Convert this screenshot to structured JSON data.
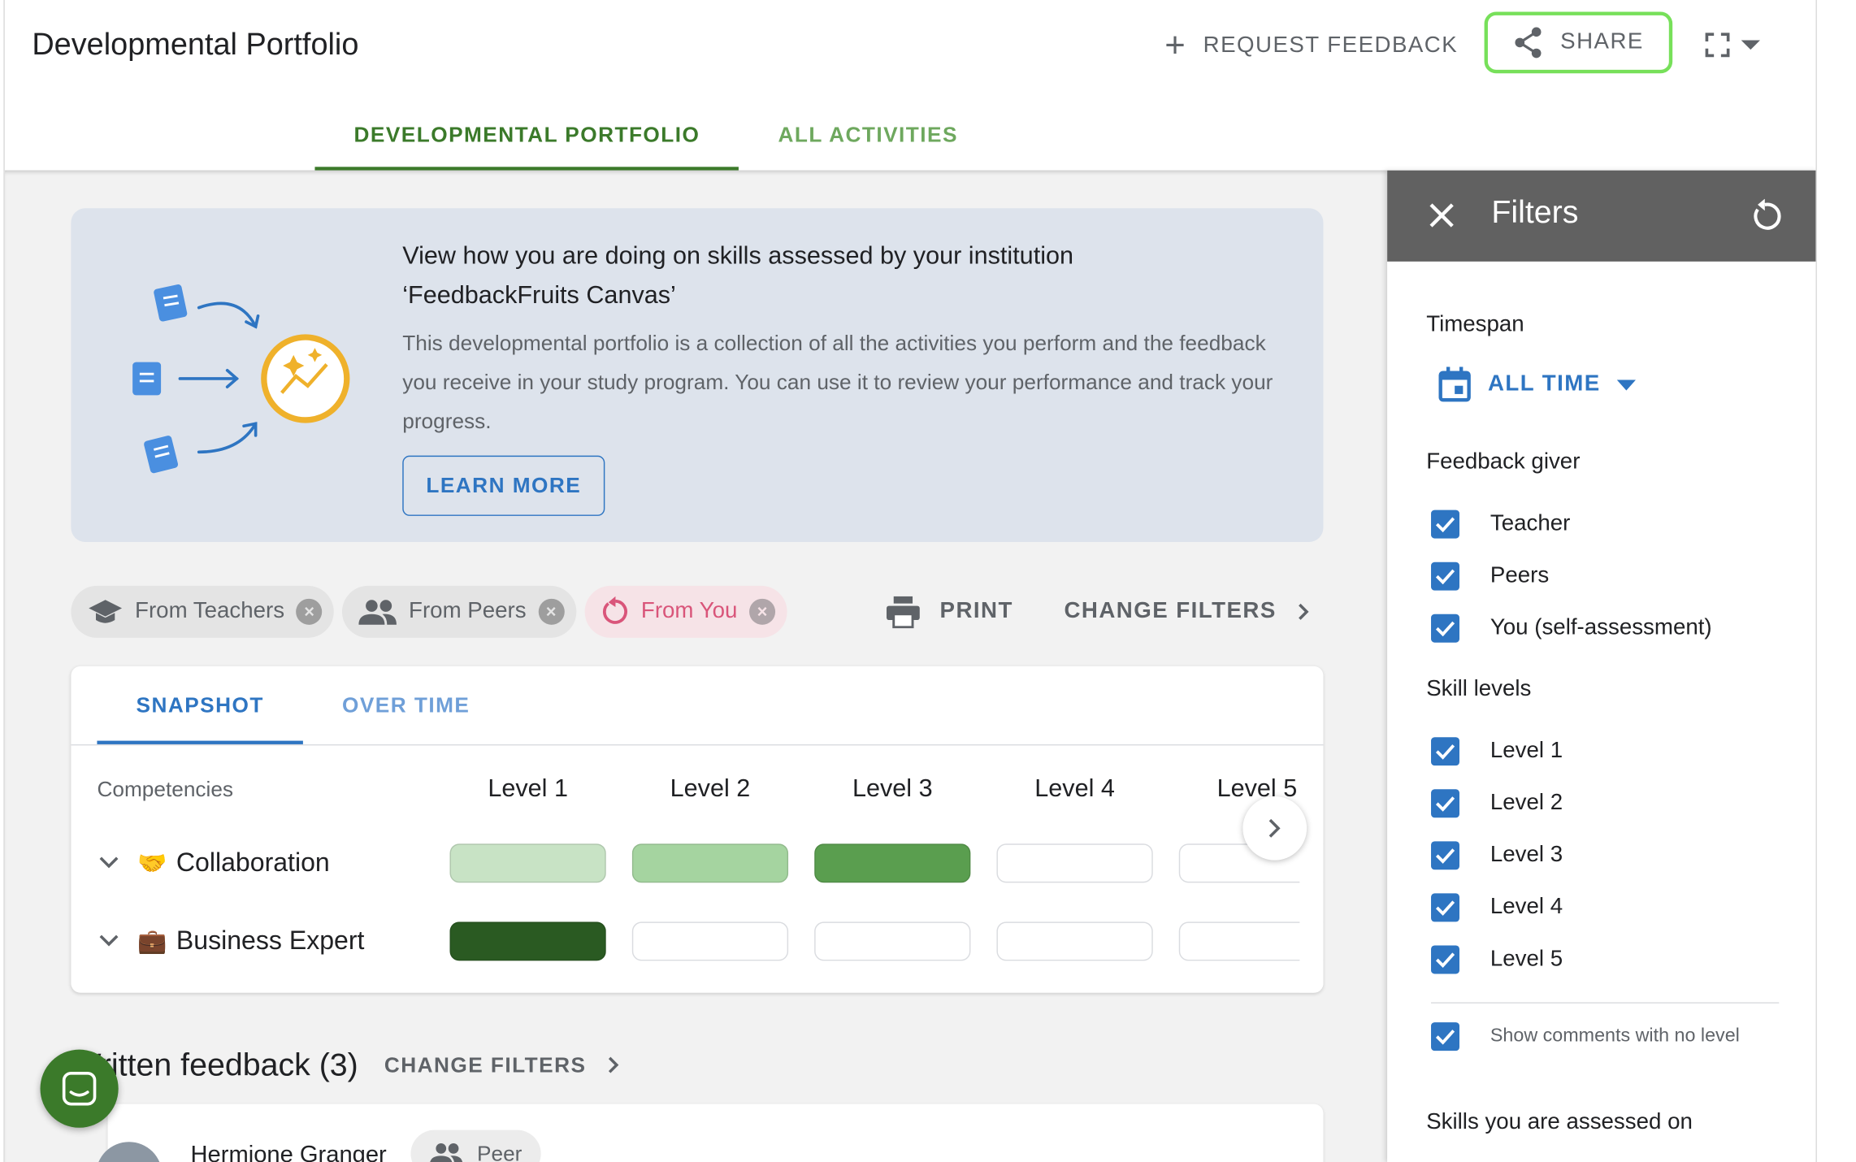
{
  "header": {
    "title": "Developmental Portfolio",
    "request_feedback": "REQUEST FEEDBACK",
    "share": "SHARE"
  },
  "tabs": [
    {
      "label": "DEVELOPMENTAL PORTFOLIO",
      "active": true
    },
    {
      "label": "ALL ACTIVITIES",
      "active": false
    }
  ],
  "banner": {
    "title_line1": "View how you are doing on skills assessed by your institution",
    "title_line2": "‘FeedbackFruits Canvas’",
    "description": "This developmental portfolio is a collection of all the activities you perform and the feedback you receive in your study program. You can use it to review your performance and track your progress.",
    "learn_more": "LEARN MORE"
  },
  "chips": [
    {
      "label": "From Teachers",
      "icon": "graduation-cap-icon"
    },
    {
      "label": "From Peers",
      "icon": "people-icon"
    },
    {
      "label": "From You",
      "icon": "self-refresh-icon"
    }
  ],
  "actions": {
    "print": "PRINT",
    "change_filters": "CHANGE FILTERS"
  },
  "snapshot": {
    "tabs": [
      {
        "label": "SNAPSHOT",
        "active": true
      },
      {
        "label": "OVER TIME",
        "active": false
      }
    ],
    "competencies_header": "Competencies",
    "levels": [
      "Level 1",
      "Level 2",
      "Level 3",
      "Level 4",
      "Level 5"
    ],
    "rows": [
      {
        "emoji": "🤝",
        "name": "Collaboration",
        "cells": [
          "#c8e3c5",
          "#a5d4a0",
          "#5a9e4f",
          "#ffffff",
          "#ffffff"
        ]
      },
      {
        "emoji": "💼",
        "name": "Business Expert",
        "cells": [
          "#2a5a22",
          "#ffffff",
          "#ffffff",
          "#ffffff",
          "#ffffff"
        ]
      }
    ]
  },
  "written_feedback": {
    "title": "Written feedback (3)",
    "change_filters": "CHANGE FILTERS",
    "first_item": {
      "name": "Hermione Granger",
      "role": "Peer"
    }
  },
  "filters": {
    "title": "Filters",
    "timespan_label": "Timespan",
    "timespan_value": "ALL TIME",
    "feedback_giver_label": "Feedback giver",
    "feedback_givers": [
      "Teacher",
      "Peers",
      "You (self-assessment)"
    ],
    "skill_levels_label": "Skill levels",
    "skill_levels": [
      "Level 1",
      "Level 2",
      "Level 3",
      "Level 4",
      "Level 5"
    ],
    "show_no_level": "Show comments with no level",
    "skills_assessed_label": "Skills you are assessed on"
  },
  "colors": {
    "primary_green": "#3b7a2a",
    "primary_blue": "#2e75c2",
    "share_highlight": "#77e05a",
    "filters_header": "#616161"
  }
}
